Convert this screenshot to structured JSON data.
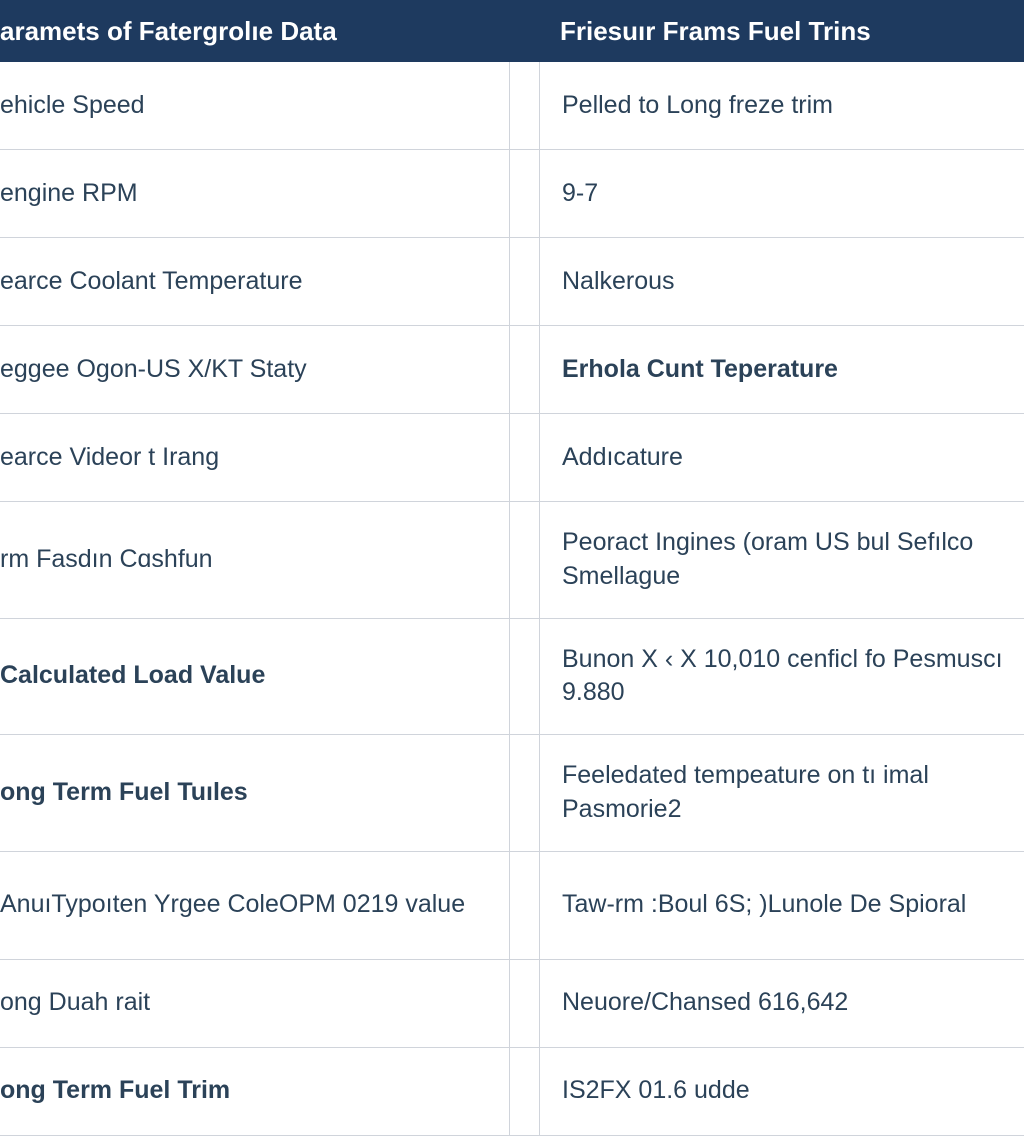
{
  "header": {
    "left": "aramets of Fatergrolıe Data",
    "right": "Friesuır Frams Fuel Trins"
  },
  "rows": [
    {
      "left": "ehicle Speed",
      "right": "Pelled to Long freze trim"
    },
    {
      "left": "engine RPM",
      "right": "9-7"
    },
    {
      "left": "earce Coolant Temperature",
      "right": "Nalkerous"
    },
    {
      "left": "eggee Oɡon-US X/KT Staty",
      "right": "Erhola Cunt Teperature"
    },
    {
      "left": "earce Videor t Irang",
      "right": "Addıcature"
    },
    {
      "left": "rm Fasdın Cɑshfun",
      "right": "Peoract Ingines (oram US bul Sefılco Smellague"
    },
    {
      "left": "Calculated Load Value",
      "right": "Bunon X ‹ X 10,010 cenficl fo Pesmuscı 9.880"
    },
    {
      "left": "ong Term Fuel Tuıles",
      "right": "Feeledated tempeature on tı imal Pasmorie2"
    },
    {
      "left": "AnuıTypoıten Yrgee ColeOPM 0219 value",
      "right": "Taw-rm :Boul 6S; )Lunole De Spioral"
    },
    {
      "left": "ong Duah rait",
      "right": "Neuore/Chansed 616,642"
    },
    {
      "left": "ong Term Fuel Trim",
      "right": "IS2FX 01.6 udde"
    }
  ]
}
